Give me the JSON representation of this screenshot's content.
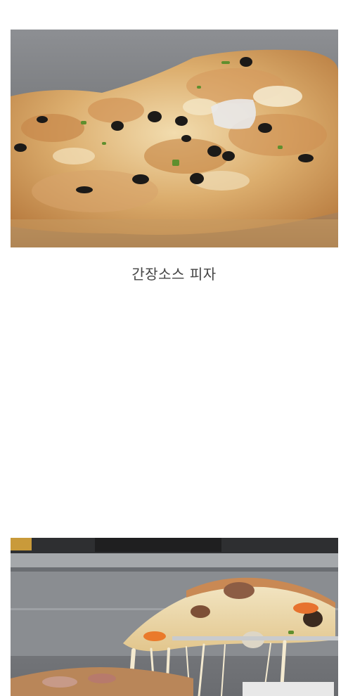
{
  "caption_1": "간장소스 피자",
  "images": [
    {
      "name": "soy-sauce-pizza-photo"
    },
    {
      "name": "cheese-pull-pizza-photo"
    }
  ]
}
